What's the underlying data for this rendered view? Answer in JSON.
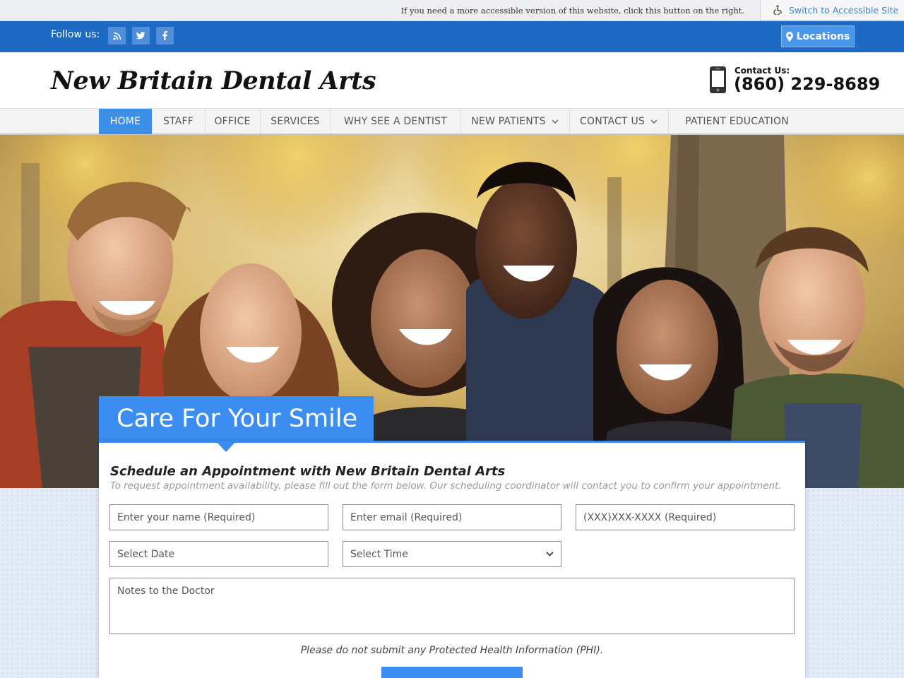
{
  "accessibility": {
    "message": "If you need a more accessible version of this website, click this button on the right.",
    "button_label": "Switch to Accessible Site"
  },
  "topbar": {
    "follow_label": "Follow us:",
    "social_icons": [
      "rss-icon",
      "twitter-icon",
      "facebook-icon"
    ],
    "locations_label": "Locations"
  },
  "header": {
    "logo_text": "New Britain Dental Arts",
    "contact_label": "Contact Us:",
    "phone": "(860) 229-8689"
  },
  "nav": {
    "items": [
      {
        "label": "HOME",
        "active": true
      },
      {
        "label": "STAFF"
      },
      {
        "label": "OFFICE"
      },
      {
        "label": "SERVICES"
      },
      {
        "label": "WHY SEE A DENTIST"
      },
      {
        "label": "NEW PATIENTS",
        "dropdown": true
      },
      {
        "label": "CONTACT US",
        "dropdown": true
      },
      {
        "label": "PATIENT EDUCATION"
      }
    ]
  },
  "hero": {
    "tab_title": "Care For Your Smile"
  },
  "form": {
    "heading": "Schedule an Appointment with New Britain Dental Arts",
    "subheading": "To request appointment availability, please fill out the form below. Our scheduling coordinator will contact you to confirm your appointment.",
    "name_placeholder": "Enter your name (Required)",
    "email_placeholder": "Enter email (Required)",
    "phone_placeholder": "(XXX)XXX-XXXX (Required)",
    "date_placeholder": "Select Date",
    "time_placeholder": "Select Time",
    "notes_placeholder": "Notes to the Doctor",
    "phi_notice": "Please do not submit any Protected Health Information (PHI)."
  },
  "colors": {
    "brand_blue": "#1c6ac4",
    "accent_blue": "#3b8ef0",
    "link_blue": "#3f80c2"
  }
}
